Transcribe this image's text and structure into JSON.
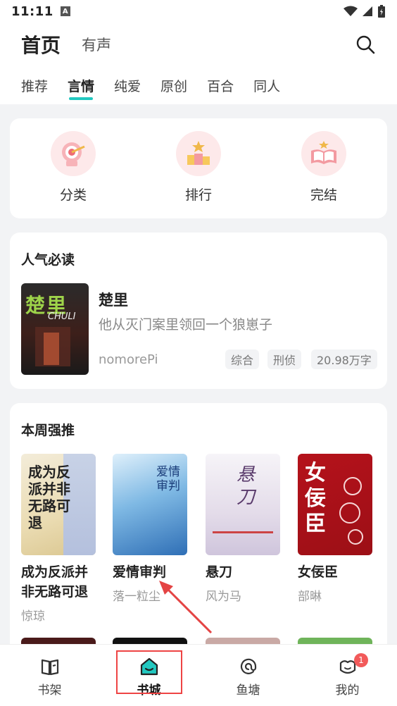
{
  "status_bar": {
    "time": "11:11",
    "notification": "A"
  },
  "header": {
    "title": "首页",
    "audio_tab": "有声"
  },
  "tabs": [
    {
      "label": "推荐"
    },
    {
      "label": "言情"
    },
    {
      "label": "纯爱"
    },
    {
      "label": "原创"
    },
    {
      "label": "百合"
    },
    {
      "label": "同人"
    }
  ],
  "quick": [
    {
      "label": "分类",
      "icon": "target-icon"
    },
    {
      "label": "排行",
      "icon": "podium-icon"
    },
    {
      "label": "完结",
      "icon": "open-book-icon"
    }
  ],
  "popular": {
    "title": "人气必读",
    "book": {
      "cover_title": "楚里",
      "cover_sub": "CHULI",
      "title": "楚里",
      "desc": "他从灭门案里领回一个狼崽子",
      "author": "nomorePi",
      "tags": [
        "综合",
        "刑侦",
        "20.98万字"
      ]
    }
  },
  "weekly": {
    "title": "本周强推",
    "books": [
      {
        "name_line1": "成为反派并",
        "name_line2": "非无路可退",
        "author": "惊琼",
        "cover_text": "成为反派并非无路可退"
      },
      {
        "name_line1": "爱情审判",
        "name_line2": "",
        "author": "落一粒尘",
        "cover_text": "爱情审判"
      },
      {
        "name_line1": "悬刀",
        "name_line2": "",
        "author": "风为马",
        "cover_text": "悬刀"
      },
      {
        "name_line1": "女佞臣",
        "name_line2": "",
        "author": "部晽",
        "cover_text": "女佞臣"
      }
    ]
  },
  "bottom_nav": [
    {
      "label": "书架",
      "icon": "bookshelf-icon"
    },
    {
      "label": "书城",
      "icon": "store-icon"
    },
    {
      "label": "鱼塘",
      "icon": "pond-icon"
    },
    {
      "label": "我的",
      "icon": "profile-icon",
      "badge": "1"
    }
  ],
  "colors": {
    "accent": "#22c8c0",
    "annotation": "#e44444"
  }
}
